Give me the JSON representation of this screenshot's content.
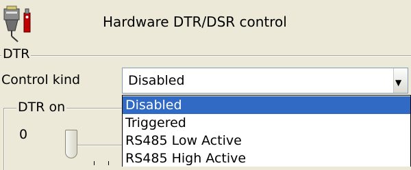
{
  "header": {
    "title": "Hardware DTR/DSR control"
  },
  "dtr_group": {
    "label": "DTR"
  },
  "control_kind": {
    "label": "Control kind",
    "value": "Disabled",
    "options": [
      "Disabled",
      "Triggered",
      "RS485 Low Active",
      "RS485 High Active"
    ],
    "selected_index": 0
  },
  "dtr_on_group": {
    "label": "DTR on"
  },
  "slider": {
    "min_label": "0"
  },
  "colors": {
    "selection": "#316ac5",
    "window": "#ece9d8"
  }
}
